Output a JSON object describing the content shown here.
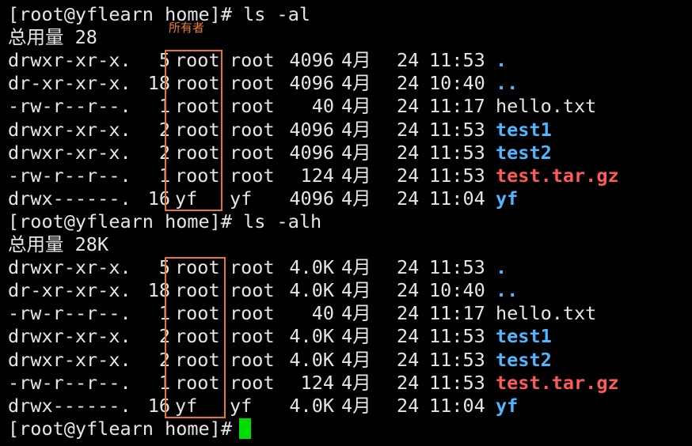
{
  "terminal": {
    "prompt": "[root@yflearn home]# ",
    "annotation": {
      "label": "所有者",
      "color": "#f07a2a"
    },
    "cursor_color": "#00dd00",
    "colors": {
      "text": "#e6e6e6",
      "directory": "#4fb6ff",
      "archive": "#ff5a5a",
      "background": "#000000",
      "box_border": "#e8772e"
    },
    "blocks": [
      {
        "command": "[root@yflearn home]# ls -al",
        "total": "总用量 28",
        "rows": [
          {
            "perms": "drwxr-xr-x.",
            "links": "5",
            "owner": "root",
            "group": "root",
            "size": "4096",
            "month": "4月",
            "day": "24",
            "time": "11:53",
            "name": ".",
            "type": "dir"
          },
          {
            "perms": "dr-xr-xr-x.",
            "links": "18",
            "owner": "root",
            "group": "root",
            "size": "4096",
            "month": "4月",
            "day": "24",
            "time": "10:40",
            "name": "..",
            "type": "dir"
          },
          {
            "perms": "-rw-r--r--.",
            "links": "1",
            "owner": "root",
            "group": "root",
            "size": "40",
            "month": "4月",
            "day": "24",
            "time": "11:17",
            "name": "hello.txt",
            "type": "file"
          },
          {
            "perms": "drwxr-xr-x.",
            "links": "2",
            "owner": "root",
            "group": "root",
            "size": "4096",
            "month": "4月",
            "day": "24",
            "time": "11:53",
            "name": "test1",
            "type": "dir"
          },
          {
            "perms": "drwxr-xr-x.",
            "links": "2",
            "owner": "root",
            "group": "root",
            "size": "4096",
            "month": "4月",
            "day": "24",
            "time": "11:53",
            "name": "test2",
            "type": "dir"
          },
          {
            "perms": "-rw-r--r--.",
            "links": "1",
            "owner": "root",
            "group": "root",
            "size": "124",
            "month": "4月",
            "day": "24",
            "time": "11:53",
            "name": "test.tar.gz",
            "type": "archive"
          },
          {
            "perms": "drwx------.",
            "links": "16",
            "owner": "yf",
            "group": "yf",
            "size": "4096",
            "month": "4月",
            "day": "24",
            "time": "11:04",
            "name": "yf",
            "type": "dir"
          }
        ]
      },
      {
        "command": "[root@yflearn home]# ls -alh",
        "total": "总用量 28K",
        "rows": [
          {
            "perms": "drwxr-xr-x.",
            "links": "5",
            "owner": "root",
            "group": "root",
            "size": "4.0K",
            "month": "4月",
            "day": "24",
            "time": "11:53",
            "name": ".",
            "type": "dir"
          },
          {
            "perms": "dr-xr-xr-x.",
            "links": "18",
            "owner": "root",
            "group": "root",
            "size": "4.0K",
            "month": "4月",
            "day": "24",
            "time": "10:40",
            "name": "..",
            "type": "dir"
          },
          {
            "perms": "-rw-r--r--.",
            "links": "1",
            "owner": "root",
            "group": "root",
            "size": "40",
            "month": "4月",
            "day": "24",
            "time": "11:17",
            "name": "hello.txt",
            "type": "file"
          },
          {
            "perms": "drwxr-xr-x.",
            "links": "2",
            "owner": "root",
            "group": "root",
            "size": "4.0K",
            "month": "4月",
            "day": "24",
            "time": "11:53",
            "name": "test1",
            "type": "dir"
          },
          {
            "perms": "drwxr-xr-x.",
            "links": "2",
            "owner": "root",
            "group": "root",
            "size": "4.0K",
            "month": "4月",
            "day": "24",
            "time": "11:53",
            "name": "test2",
            "type": "dir"
          },
          {
            "perms": "-rw-r--r--.",
            "links": "1",
            "owner": "root",
            "group": "root",
            "size": "124",
            "month": "4月",
            "day": "24",
            "time": "11:53",
            "name": "test.tar.gz",
            "type": "archive"
          },
          {
            "perms": "drwx------.",
            "links": "16",
            "owner": "yf",
            "group": "yf",
            "size": "4.0K",
            "month": "4月",
            "day": "24",
            "time": "11:04",
            "name": "yf",
            "type": "dir"
          }
        ]
      }
    ],
    "final_prompt": "[root@yflearn home]#"
  }
}
